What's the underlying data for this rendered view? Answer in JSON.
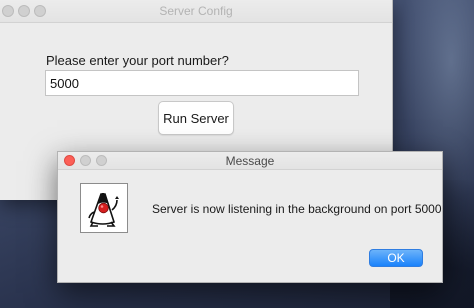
{
  "main_window": {
    "title": "Server Config",
    "prompt": "Please enter your port number?",
    "port_value": "5000",
    "run_button_label": "Run Server"
  },
  "message_dialog": {
    "title": "Message",
    "icon": "java-duke-icon",
    "text": "Server is now listening in the background on port 5000",
    "ok_label": "OK"
  },
  "colors": {
    "close_button": "#fc5f57",
    "ok_button": "#1a82fb",
    "window_bg": "#ececec"
  }
}
